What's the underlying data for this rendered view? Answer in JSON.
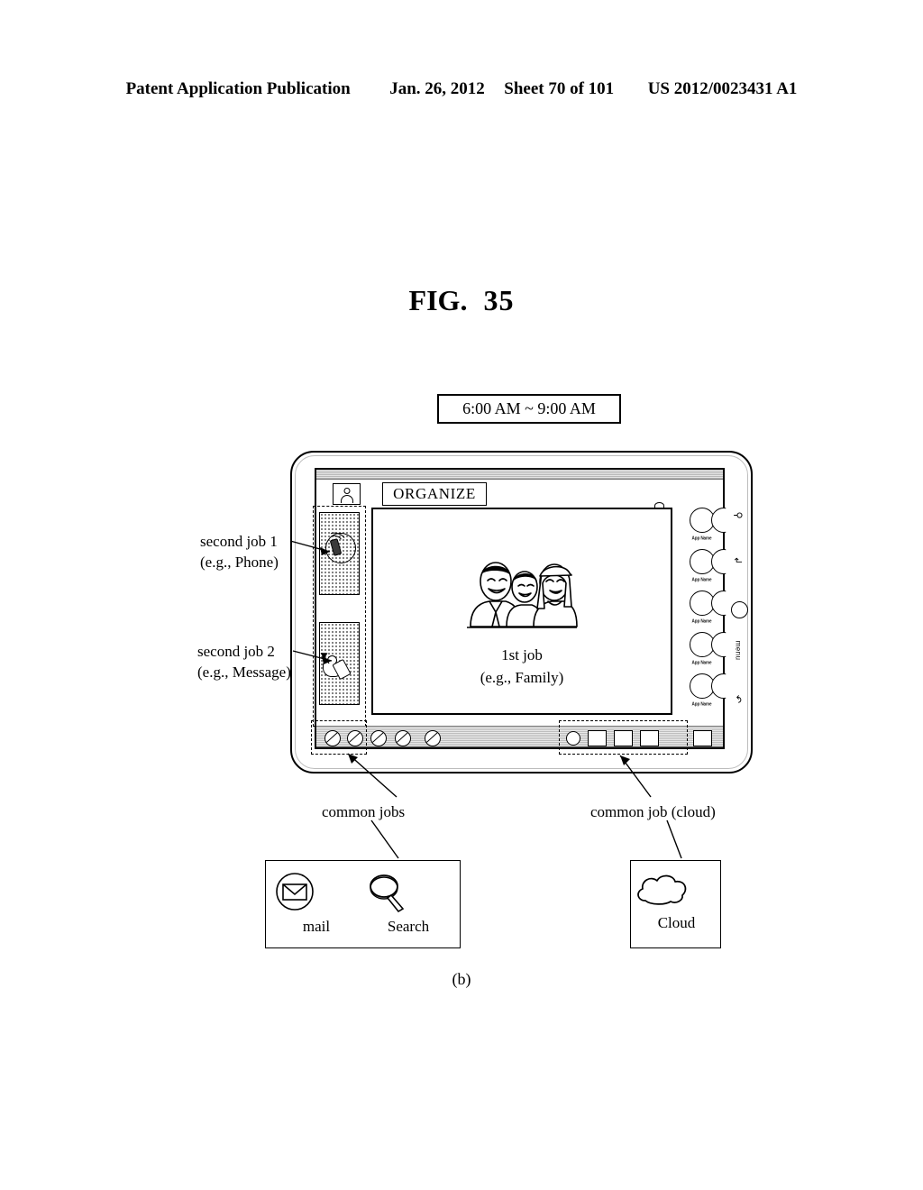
{
  "header": {
    "publication": "Patent Application Publication",
    "date": "Jan. 26, 2012",
    "sheet": "Sheet 70 of 101",
    "number": "US 2012/0023431 A1"
  },
  "figure": {
    "label_fig": "FIG.",
    "label_num": "35",
    "subfigure": "(b)"
  },
  "time_range": {
    "text": "6:00 AM ~ 9:00 AM"
  },
  "device": {
    "title_bar": {
      "avatar_icon": "user-avatar-icon",
      "organize_label": "ORGANIZE"
    },
    "main_panel": {
      "image_icon": "family-photo-icon",
      "caption_line_1": "1st job",
      "caption_line_2": "(e.g., Family)"
    },
    "sidebar_jobs": [
      {
        "icon": "phone-icon",
        "name": "second job 1"
      },
      {
        "icon": "message-icon",
        "name": "second job 2"
      }
    ],
    "app_column": [
      {
        "label": "App Name"
      },
      {
        "label": "App Name"
      },
      {
        "label": "App Name"
      },
      {
        "label": "App Name"
      },
      {
        "label": "App Name"
      }
    ],
    "hardware_buttons": [
      {
        "icon": "search-icon",
        "label": ""
      },
      {
        "icon": "back-arrow-icon",
        "label": ""
      },
      {
        "icon": "home-circle-icon",
        "label": ""
      },
      {
        "icon": "menu-icon",
        "label": "menu"
      },
      {
        "icon": "return-arrow-icon",
        "label": ""
      }
    ],
    "taskbar": {
      "left_icons": [
        {
          "icon": "slashed-circle-icon"
        },
        {
          "icon": "slashed-circle-icon"
        },
        {
          "icon": "slashed-circle-icon"
        },
        {
          "icon": "slashed-circle-icon"
        },
        {
          "icon": "slashed-circle-icon"
        }
      ],
      "right_icons": [
        {
          "icon": "filled-circle-icon"
        },
        {
          "icon": "square-icon"
        },
        {
          "icon": "square-icon"
        },
        {
          "icon": "square-icon"
        },
        {
          "icon": "square-icon"
        }
      ]
    }
  },
  "annotations": {
    "second_job_1": {
      "line_1": "second job 1",
      "line_2": "(e.g., Phone)"
    },
    "second_job_2": {
      "line_1": "second job 2",
      "line_2": "(e.g., Message)"
    },
    "common_jobs": "common jobs",
    "common_job_cloud": "common job (cloud)"
  },
  "callouts": {
    "common_jobs_box": {
      "items": [
        {
          "icon": "mail-icon",
          "label": "mail"
        },
        {
          "icon": "search-magnifier-icon",
          "label": "Search"
        }
      ]
    },
    "cloud_box": {
      "item": {
        "icon": "cloud-icon",
        "label": "Cloud"
      }
    }
  },
  "colors": {
    "ink": "#000000",
    "paper": "#ffffff",
    "chrome_gray": "#c9c9c9"
  }
}
